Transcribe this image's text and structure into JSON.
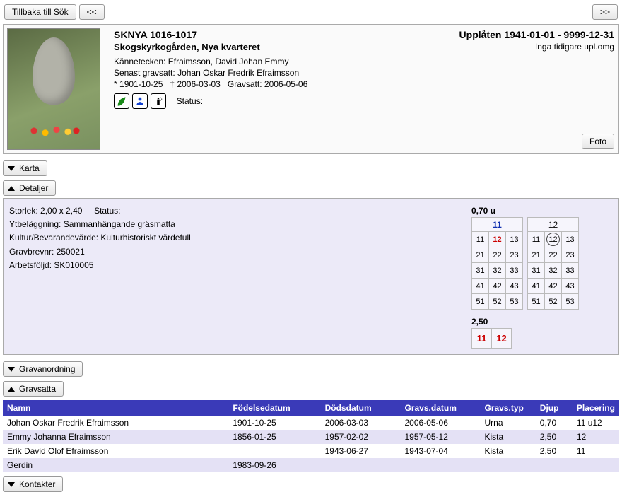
{
  "topbar": {
    "back_label": "Tillbaka till Sök",
    "prev_label": "<<",
    "next_label": ">>"
  },
  "card": {
    "title": "SKNYA 1016-1017",
    "subtitle": "Skogskyrkogården, Nya kvarteret",
    "kannetecken_label": "Kännetecken:",
    "kannetecken_value": "Efraimsson, David Johan Emmy",
    "senast_label": "Senast gravsatt:",
    "senast_value": "Johan Oskar Fredrik Efraimsson",
    "birth_prefix": "*",
    "birth": "1901-10-25",
    "death_prefix": "†",
    "death": "2006-03-03",
    "gravsatt_label": "Gravsatt:",
    "gravsatt_value": "2006-05-06",
    "status_label": "Status:",
    "right_title": "Upplåten 1941-01-01 - 9999-12-31",
    "right_sub": "Inga tidigare upl.omg",
    "foto_label": "Foto"
  },
  "sections": {
    "karta": "Karta",
    "detaljer": "Detaljer",
    "gravanordning": "Gravanordning",
    "gravsatta": "Gravsatta",
    "kontakter": "Kontakter"
  },
  "details": {
    "storlek_label": "Storlek:",
    "storlek_value": "2,00 x 2,40",
    "status_label": "Status:",
    "ytbelaggning_label": "Ytbeläggning:",
    "ytbelaggning_value": "Sammanhängande gräsmatta",
    "kultur_label": "Kultur/Bevarandevärde:",
    "kultur_value": "Kulturhistoriskt värdefull",
    "gravbrev_label": "Gravbrevnr:",
    "gravbrev_value": "250021",
    "arbetsfoljd_label": "Arbetsföljd:",
    "arbetsfoljd_value": "SK010005"
  },
  "plots": {
    "upper_label": "0,70 u",
    "col11_label": "11",
    "col12_label": "12",
    "rows": [
      [
        "11",
        "12",
        "13"
      ],
      [
        "21",
        "22",
        "23"
      ],
      [
        "31",
        "32",
        "33"
      ],
      [
        "41",
        "42",
        "43"
      ],
      [
        "51",
        "52",
        "53"
      ]
    ],
    "lower_label": "2,50",
    "lower_cells": [
      "11",
      "12"
    ]
  },
  "table": {
    "columns": [
      "Namn",
      "Födelsedatum",
      "Dödsdatum",
      "Gravs.datum",
      "Gravs.typ",
      "Djup",
      "Placering"
    ],
    "rows": [
      {
        "namn": "Johan Oskar Fredrik Efraimsson",
        "fodelse": "1901-10-25",
        "dods": "2006-03-03",
        "gravs": "2006-05-06",
        "typ": "Urna",
        "djup": "0,70",
        "plac": "11 u12"
      },
      {
        "namn": "Emmy Johanna Efraimsson",
        "fodelse": "1856-01-25",
        "dods": "1957-02-02",
        "gravs": "1957-05-12",
        "typ": "Kista",
        "djup": "2,50",
        "plac": "12"
      },
      {
        "namn": "Erik David Olof Efraimsson",
        "fodelse": "",
        "dods": "1943-06-27",
        "gravs": "1943-07-04",
        "typ": "Kista",
        "djup": "2,50",
        "plac": "11"
      },
      {
        "namn": "Gerdin",
        "fodelse": "1983-09-26",
        "dods": "",
        "gravs": "",
        "typ": "",
        "djup": "",
        "plac": ""
      }
    ]
  }
}
